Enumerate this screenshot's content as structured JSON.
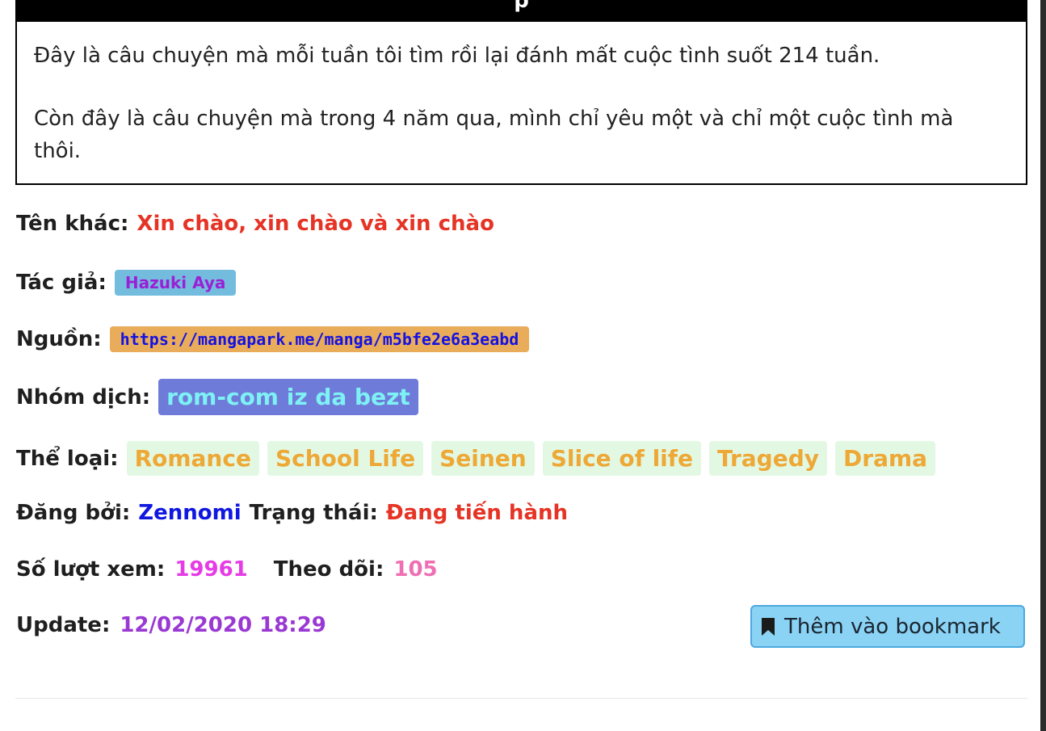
{
  "header": {
    "title": "p"
  },
  "description": {
    "para1": "Đây là câu chuyện mà mỗi tuần tôi tìm rồi lại đánh mất cuộc tình suốt 214 tuần.",
    "para2": "Còn đây là câu chuyện mà trong 4 năm qua, mình chỉ yêu một và chỉ một cuộc tình mà thôi."
  },
  "info": {
    "alt_name_label": "Tên khác:",
    "alt_name": "Xin chào, xin chào và xin chào",
    "author_label": "Tác giả:",
    "author": "Hazuki Aya",
    "source_label": "Nguồn:",
    "source": "https://mangapark.me/manga/m5bfe2e6a3eabd",
    "team_label": "Nhóm dịch:",
    "team": "rom-com iz da bezt",
    "genre_label": "Thể loại:",
    "genres": [
      "Romance",
      "School Life",
      "Seinen",
      "Slice of life",
      "Tragedy",
      "Drama"
    ],
    "posted_by_label": "Đăng bởi:",
    "posted_by": "Zennomi",
    "status_label": "Trạng thái:",
    "status": "Đang tiến hành",
    "views_label": "Số lượt xem:",
    "views": "19961",
    "follows_label": "Theo dõi:",
    "follows": "105",
    "update_label": "Update:",
    "update": "12/02/2020 18:29"
  },
  "bookmark": {
    "label": "Thêm vào bookmark",
    "icon": "bookmark-icon"
  },
  "colors": {
    "alt_name": "#e53425",
    "author_bg": "#74bcde",
    "source_bg": "#e8ac5a",
    "team_bg": "#6f7bd8",
    "tag_bg": "#e3f8e3",
    "tag_text": "#eda836",
    "button_bg": "#8ad3f4"
  }
}
